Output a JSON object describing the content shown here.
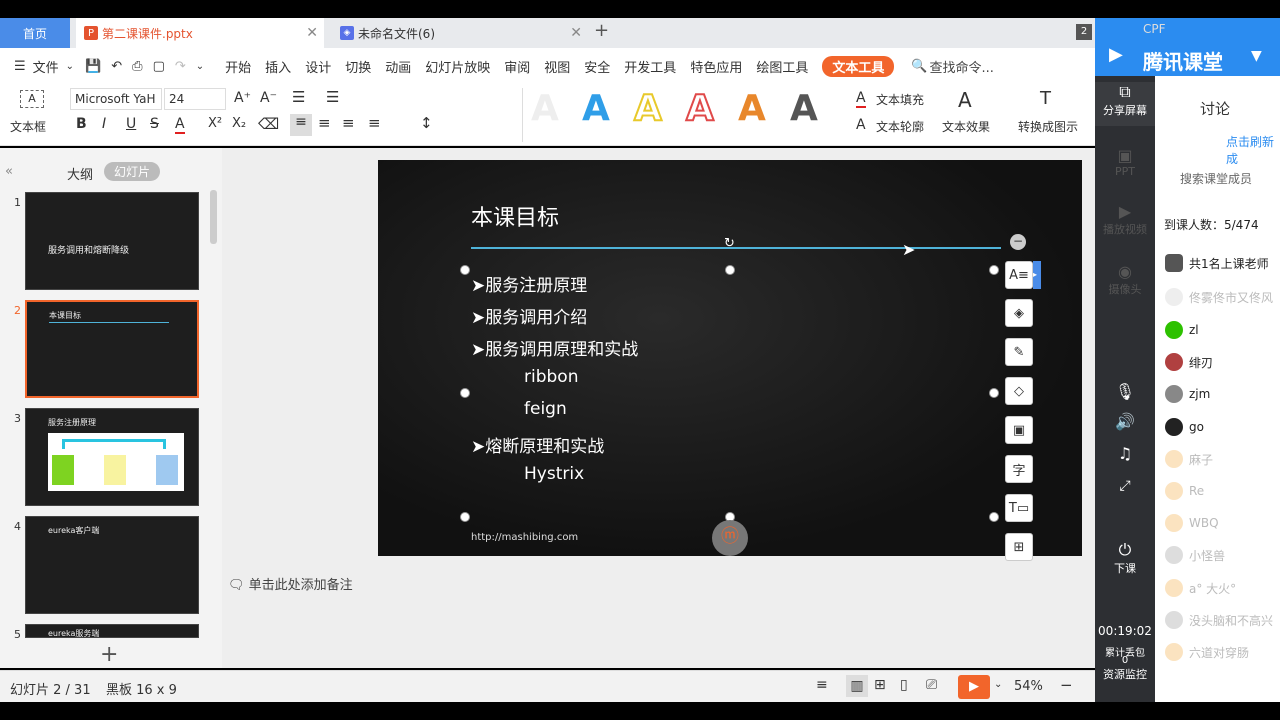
{
  "tabs": {
    "home": "首页",
    "pptx": "第二课课件.pptx",
    "untitled": "未命名文件(6)",
    "badge": "2"
  },
  "menu": [
    "文件",
    "开始",
    "插入",
    "设计",
    "切换",
    "动画",
    "幻灯片放映",
    "审阅",
    "视图",
    "安全",
    "开发工具",
    "特色应用",
    "绘图工具",
    "文本工具"
  ],
  "menu_search": "查找命令...",
  "ribbon": {
    "textbox": "文本框",
    "font": "Microsoft YaH",
    "size": "24",
    "fill": "文本填充",
    "outline": "文本轮廓",
    "effect": "文本效果",
    "convert": "转换成图示"
  },
  "left_pane": {
    "tab_outline": "大纲",
    "tab_slides": "幻灯片",
    "thumbs": [
      {
        "num": "1",
        "title": "服务调用和熔断降级"
      },
      {
        "num": "2",
        "title": "本课目标"
      },
      {
        "num": "3",
        "title": "服务注册原理"
      },
      {
        "num": "4",
        "title": "eureka客户端"
      },
      {
        "num": "5",
        "title": "eureka服务端"
      }
    ]
  },
  "slide": {
    "title": "本课目标",
    "bullets": [
      "➤服务注册原理",
      "➤服务调用介绍",
      "➤服务调用原理和实战",
      "ribbon",
      "feign",
      "➤熔断原理和实战",
      "Hystrix"
    ],
    "footer": "http://mashibing.com"
  },
  "notes_placeholder": "单击此处添加备注",
  "status": {
    "slide_counter": "幻灯片 2 / 31",
    "theme": "黑板 16 x 9",
    "zoom": "54%"
  },
  "right_panel": {
    "brand": "腾讯课堂",
    "user": "CPF",
    "share_screen": "分享屏幕",
    "ppt": "PPT",
    "video": "播放视频",
    "camera": "摄像头",
    "end_class": "下课",
    "timer": "00:19:02",
    "packet_loss": "累计丢包",
    "packet_value": "0",
    "monitor": "资源监控",
    "discuss": "讨论",
    "refresh": "点击刷新成",
    "search": "搜索课堂成员",
    "attendance": "到课人数：5/474",
    "members": [
      {
        "name": "共1名上课老师",
        "dim": false
      },
      {
        "name": "佟雾佟市又佟风",
        "dim": true
      },
      {
        "name": "zl",
        "dim": false
      },
      {
        "name": "绯刃",
        "dim": false
      },
      {
        "name": "zjm",
        "dim": false
      },
      {
        "name": "go",
        "dim": false
      },
      {
        "name": "麻子",
        "dim": true
      },
      {
        "name": "Re",
        "dim": true
      },
      {
        "name": "WBQ",
        "dim": true
      },
      {
        "name": "小怪兽",
        "dim": true
      },
      {
        "name": "a° 大火°",
        "dim": true
      },
      {
        "name": "没头脑和不高兴",
        "dim": true
      },
      {
        "name": "六道对穿肠",
        "dim": true
      }
    ]
  }
}
